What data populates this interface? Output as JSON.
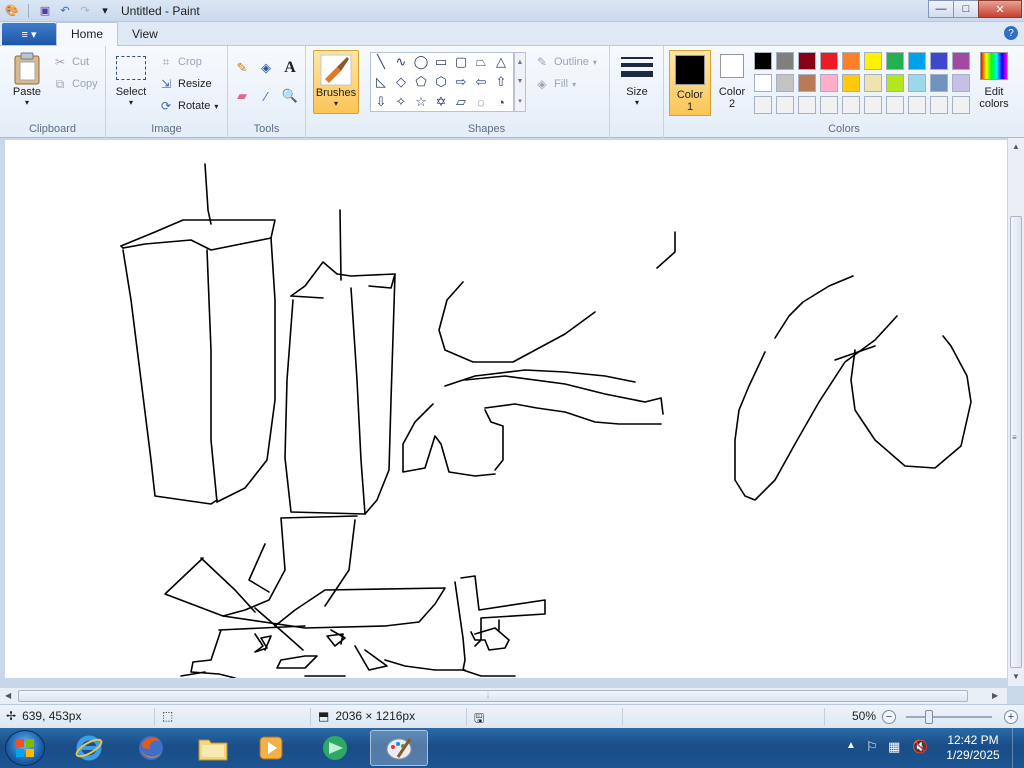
{
  "window": {
    "title": "Untitled - Paint",
    "buttons": {
      "minimize": "—",
      "maximize": "□",
      "close": "✕"
    }
  },
  "qat": {
    "dropdown": "▾"
  },
  "tabs": [
    {
      "label": "Home",
      "active": true
    },
    {
      "label": "View",
      "active": false
    }
  ],
  "appmenu_icon": "≡ ▾",
  "help_icon": "?",
  "ribbon": {
    "clipboard": {
      "label": "Clipboard",
      "paste": "Paste",
      "cut": "Cut",
      "copy": "Copy"
    },
    "image": {
      "label": "Image",
      "select": "Select",
      "crop": "Crop",
      "resize": "Resize",
      "rotate": "Rotate"
    },
    "tools": {
      "label": "Tools"
    },
    "brushes": {
      "label": "Brushes"
    },
    "shapes": {
      "label": "Shapes",
      "outline": "Outline",
      "fill": "Fill"
    },
    "size": {
      "label": "Size"
    },
    "colors": {
      "label": "Colors",
      "color1": "Color",
      "color1_num": "1",
      "color2": "Color",
      "color2_num": "2",
      "edit": "Edit",
      "edit2": "colors",
      "color1_value": "#000000",
      "color2_value": "#ffffff",
      "palette_row1": [
        "#000000",
        "#7f7f7f",
        "#880015",
        "#ed1c24",
        "#ff7f27",
        "#fff200",
        "#22b14c",
        "#00a2e8",
        "#3f48cc",
        "#a349a4"
      ],
      "palette_row2": [
        "#ffffff",
        "#c3c3c3",
        "#b97a57",
        "#ffaec9",
        "#ffc90e",
        "#efe4b0",
        "#b5e61d",
        "#99d9ea",
        "#7092be",
        "#c8bfe7"
      ],
      "palette_row3": [
        "#f1f1f1",
        "#f1f1f1",
        "#f1f1f1",
        "#f1f1f1",
        "#f1f1f1",
        "#f1f1f1",
        "#f1f1f1",
        "#f1f1f1",
        "#f1f1f1",
        "#f1f1f1"
      ]
    }
  },
  "status": {
    "cursor_pos": "639, 453px",
    "image_size": "2036 × 1216px",
    "zoom": "50%"
  },
  "taskbar": {
    "apps": [
      "start-orb",
      "internet-explorer",
      "firefox",
      "file-explorer",
      "media-player",
      "app-green",
      "paint"
    ],
    "time": "12:42 PM",
    "date": "1/29/2025"
  }
}
